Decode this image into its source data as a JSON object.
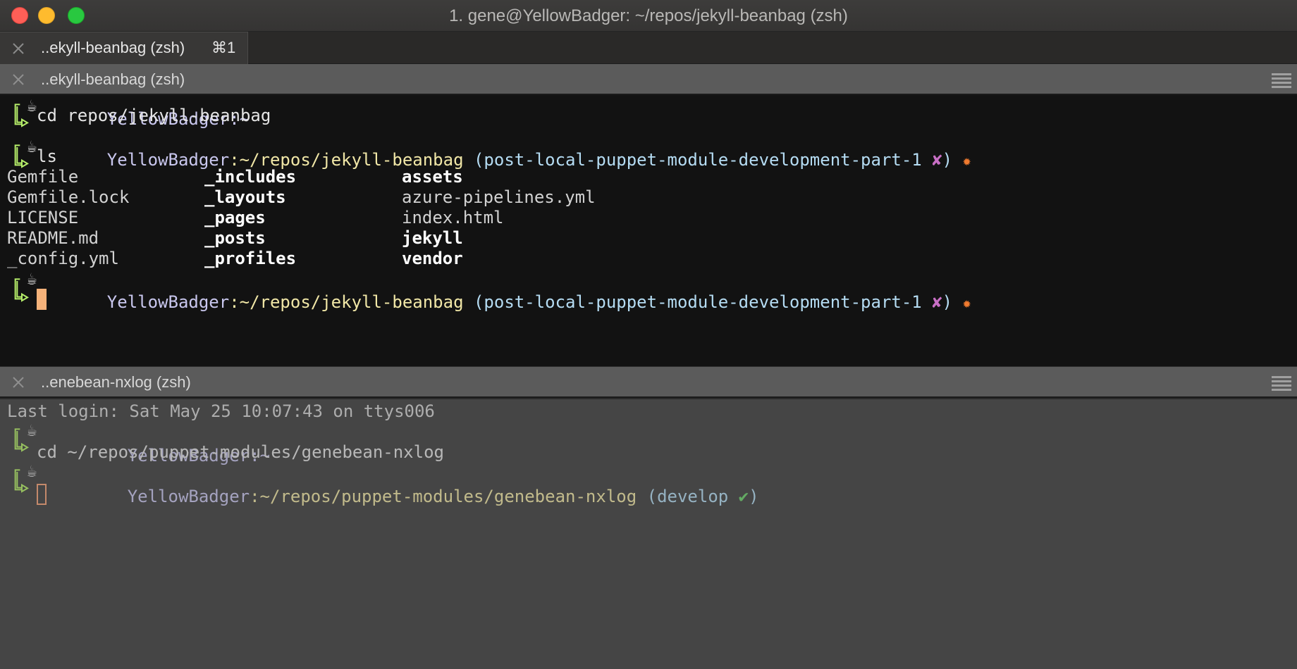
{
  "window": {
    "title": "1. gene@YellowBadger: ~/repos/jekyll-beanbag (zsh)"
  },
  "tabs": [
    {
      "label": "..ekyll-beanbag (zsh)",
      "shortcut": "⌘1"
    }
  ],
  "panes": {
    "top": {
      "header": "..ekyll-beanbag (zsh)",
      "prompt1": {
        "host": "YellowBadger",
        "path": ":~"
      },
      "cmd1": "cd repos/jekyll-beanbag",
      "prompt2": {
        "host": "YellowBadger",
        "path": ":~/repos/jekyll-beanbag",
        "branch": "(post-local-puppet-module-development-part-1",
        "dirty_mark": "✘",
        "close_paren": ")",
        "star": "✹"
      },
      "cmd2": "ls",
      "ls_columns": [
        [
          {
            "name": "Gemfile",
            "dir": false
          },
          {
            "name": "Gemfile.lock",
            "dir": false
          },
          {
            "name": "LICENSE",
            "dir": false
          },
          {
            "name": "README.md",
            "dir": false
          },
          {
            "name": "_config.yml",
            "dir": false
          }
        ],
        [
          {
            "name": "_includes",
            "dir": true
          },
          {
            "name": "_layouts",
            "dir": true
          },
          {
            "name": "_pages",
            "dir": true
          },
          {
            "name": "_posts",
            "dir": true
          },
          {
            "name": "_profiles",
            "dir": true
          }
        ],
        [
          {
            "name": "assets",
            "dir": true
          },
          {
            "name": "azure-pipelines.yml",
            "dir": false
          },
          {
            "name": "index.html",
            "dir": false
          },
          {
            "name": "jekyll",
            "dir": true
          },
          {
            "name": "vendor",
            "dir": true
          }
        ]
      ],
      "prompt3": {
        "host": "YellowBadger",
        "path": ":~/repos/jekyll-beanbag",
        "branch": "(post-local-puppet-module-development-part-1",
        "dirty_mark": "✘",
        "close_paren": ")",
        "star": "✹"
      }
    },
    "bottom": {
      "header": "..enebean-nxlog (zsh)",
      "last_login": "Last login: Sat May 25 10:07:43 on ttys006",
      "prompt1": {
        "host": "YellowBadger",
        "path": ":~"
      },
      "cmd1": "cd ~/repos/puppet-modules/genebean-nxlog",
      "prompt2": {
        "host": "YellowBadger",
        "path": ":~/repos/puppet-modules/genebean-nxlog",
        "branch": "(develop",
        "clean_mark": "✔",
        "close_paren": ")"
      }
    }
  },
  "colors": {
    "host": "#c9c7ee",
    "path": "#f1e7a7",
    "git": "#b5dcf3",
    "dirty": "#c86fc5",
    "clean": "#6fd16f",
    "arrow": "#b6ee6a",
    "cursor": "#f5b27a"
  },
  "icons": {
    "prompt_icon": "coffee-cup-icon",
    "prompt_bracket": "prompt-bracket-arrow-icon"
  }
}
